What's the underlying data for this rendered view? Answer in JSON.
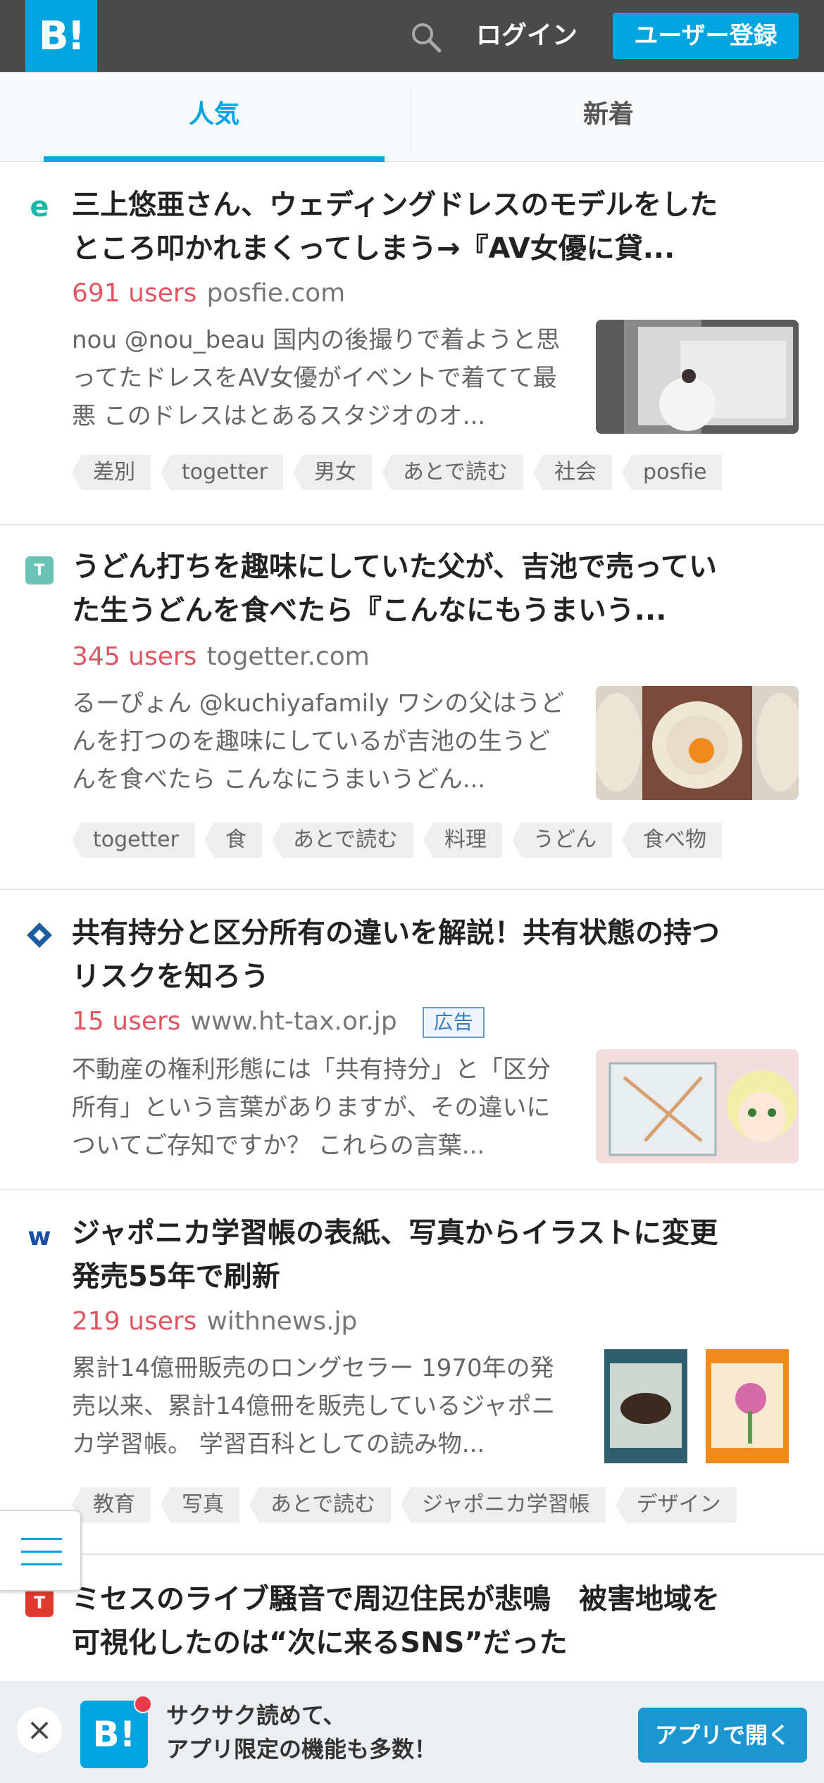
{
  "header": {
    "logo": "B!",
    "login": "ログイン",
    "signup": "ユーザー登録"
  },
  "tabs": [
    {
      "label": "人気",
      "active": true
    },
    {
      "label": "新着",
      "active": false
    }
  ],
  "entries": [
    {
      "title": "三上悠亜さん、ウェディングドレスのモデルをしたところ叩かれまくってしまう→『AV女優に貸...",
      "users": "691 users",
      "domain": "posfie.com",
      "ad": "",
      "description": "nou @nou_beau 国内の後撮りで着ようと思ってたドレスをAV女優がイベントで着てて最悪 このドレスはとあるスタジオのオ...",
      "tags": [
        "差別",
        "togetter",
        "男女",
        "あとで読む",
        "社会",
        "posfie"
      ],
      "favicon_color": "#1bb7a8"
    },
    {
      "title": "うどん打ちを趣味にしていた父が、吉池で売っていた生うどんを食べたら『こんなにもうまいう...",
      "users": "345 users",
      "domain": "togetter.com",
      "ad": "",
      "description": "るーぴょん @kuchiyafamily ワシの父はうどんを打つのを趣味にしているが吉池の生うどんを食べたら こんなにうまいうどん...",
      "tags": [
        "togetter",
        "食",
        "あとで読む",
        "料理",
        "うどん",
        "食べ物"
      ],
      "favicon_color": "#6ac3b5"
    },
    {
      "title": "共有持分と区分所有の違いを解説！共有状態の持つリスクを知ろう",
      "users": "15 users",
      "domain": "www.ht-tax.or.jp",
      "ad": "広告",
      "description": "不動産の権利形態には「共有持分」と「区分所有」という言葉がありますが、その違いについてご存知ですか？ これらの言葉...",
      "tags": [],
      "favicon_color": "#1f5c9e"
    },
    {
      "title": "ジャポニカ学習帳の表紙、写真からイラストに変更　発売55年で刷新",
      "users": "219 users",
      "domain": "withnews.jp",
      "ad": "",
      "description": "累計14億冊販売のロングセラー 1970年の発売以来、累計14億冊を販売しているジャポニカ学習帳。 学習百科としての読み物...",
      "tags": [
        "教育",
        "写真",
        "あとで読む",
        "ジャポニカ学習帳",
        "デザイン"
      ],
      "favicon_color": "#1a4fa3"
    },
    {
      "title": "ミセスのライブ騒音で周辺住民が悲鳴　被害地域を可視化したのは“次に来るSNS”だった",
      "users": "",
      "domain": "",
      "ad": "",
      "description": "",
      "tags": [],
      "favicon_color": "#e03a2f"
    }
  ],
  "banner": {
    "line1": "サクサク読めて、",
    "line2": "アプリ限定の機能も多数！",
    "open_button": "アプリで開く",
    "close_icon": "×",
    "logo": "B!"
  },
  "colors": {
    "brand": "#00a4de",
    "users": "#e05561",
    "header_bg": "#4a4a4a"
  }
}
